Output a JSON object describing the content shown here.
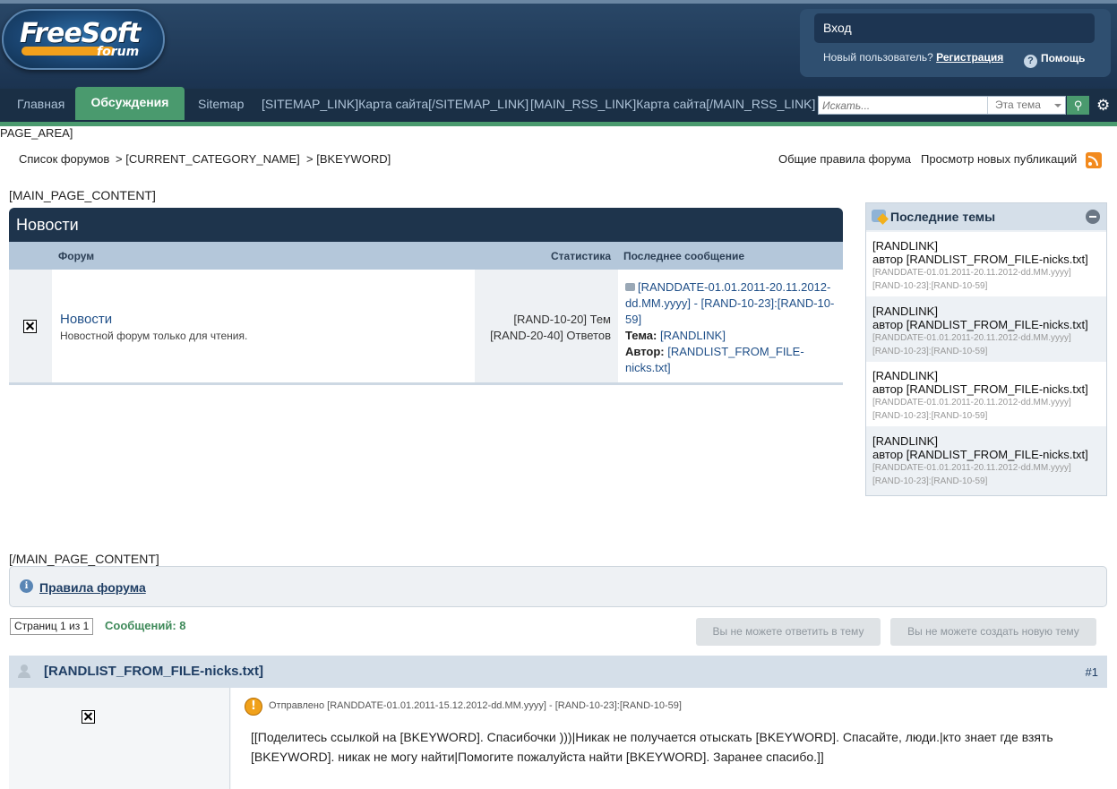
{
  "header": {
    "logo": {
      "text_main": "FreeSoft",
      "text_sub": "forum"
    },
    "login_label": "Вход",
    "new_user_text": "Новый пользователь?",
    "register_label": "Регистрация",
    "help_label": "Помощь"
  },
  "nav": {
    "items": [
      "Главная",
      "Обсуждения",
      "Sitemap",
      "[SITEMAP_LINK]Карта сайта[/SITEMAP_LINK]",
      "[MAIN_RSS_LINK]Карта сайта[/MAIN_RSS_LINK]"
    ],
    "active_index": 1,
    "search_placeholder": "Искать...",
    "search_scope": "Эта тема"
  },
  "page_area": "PAGE_AREA]",
  "breadcrumb": {
    "items": [
      "Список форумов",
      "> [CURRENT_CATEGORY_NAME]",
      "> [BKEYWORD]"
    ],
    "right_links": [
      "Общие правила форума",
      "Просмотр новых публикаций"
    ]
  },
  "main_content_open": "[MAIN_PAGE_CONTENT]",
  "main_content_close": "[/MAIN_PAGE_CONTENT]",
  "forum_block": {
    "title": "Новости",
    "columns": {
      "forum": "Форум",
      "stats": "Статистика",
      "last": "Последнее сообщение"
    },
    "row": {
      "name": "Новости",
      "description": "Новостной форум только для чтения.",
      "topics": "[RAND-10-20] Тем",
      "replies": "[RAND-20-40] Ответов",
      "last_post_link": "[RANDDATE-01.01.2011-20.11.2012-dd.MM.yyyy] - [RAND-10-23]:[RAND-10-59]",
      "topic_label": "Тема:",
      "topic_value": "[RANDLINK]",
      "author_label": "Автор:",
      "author_value": "[RANDLIST_FROM_FILE-nicks.txt]"
    }
  },
  "sidebar": {
    "title": "Последние темы",
    "items": [
      {
        "link": "[RANDLINK]",
        "author": "автор [RANDLIST_FROM_FILE-nicks.txt]",
        "date": "[RANDDATE-01.01.2011-20.11.2012-dd.MM.yyyy]",
        "time": "[RAND-10-23]:[RAND-10-59]"
      },
      {
        "link": "[RANDLINK]",
        "author": "автор [RANDLIST_FROM_FILE-nicks.txt]",
        "date": "[RANDDATE-01.01.2011-20.11.2012-dd.MM.yyyy]",
        "time": "[RAND-10-23]:[RAND-10-59]"
      },
      {
        "link": "[RANDLINK]",
        "author": "автор [RANDLIST_FROM_FILE-nicks.txt]",
        "date": "[RANDDATE-01.01.2011-20.11.2012-dd.MM.yyyy]",
        "time": "[RAND-10-23]:[RAND-10-59]"
      },
      {
        "link": "[RANDLINK]",
        "author": "автор [RANDLIST_FROM_FILE-nicks.txt]",
        "date": "[RANDDATE-01.01.2011-20.11.2012-dd.MM.yyyy]",
        "time": "[RAND-10-23]:[RAND-10-59]"
      }
    ]
  },
  "rules": {
    "label": "Правила форума"
  },
  "pagination": {
    "text": "Страниц 1 из 1",
    "message_count": "Сообщений: 8"
  },
  "buttons": {
    "reply": "Вы не можете ответить в тему",
    "new_topic": "Вы не можете создать новую тему"
  },
  "post": {
    "author": "[RANDLIST_FROM_FILE-nicks.txt]",
    "number": "#1",
    "posted": "Отправлено [RANDDATE-01.01.2011-15.12.2012-dd.MM.yyyy] - [RAND-10-23]:[RAND-10-59]",
    "text": "[[Поделитесь ссылкой на [BKEYWORD]. Спасибочки )))|Никак не получается отыскать [BKEYWORD]. Спасайте, люди.|кто знает где взять [BKEYWORD]. никак не могу найти|Помогите пожалуйста найти [BKEYWORD]. Заранее спасибо.]]"
  }
}
